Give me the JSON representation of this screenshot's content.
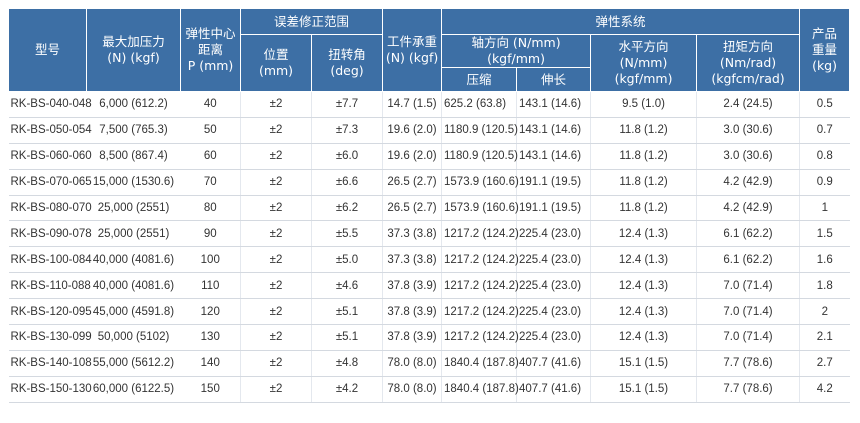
{
  "headers": {
    "model": "型号",
    "max_force": [
      "最大加压力",
      "(N) (kgf)"
    ],
    "elastic_center": [
      "弹性中心",
      "距离",
      "P (mm)"
    ],
    "error_correction": "误差修正范围",
    "position": [
      "位置",
      "(mm)"
    ],
    "torsion_angle": [
      "扭转角",
      "(deg)"
    ],
    "workpiece_load": [
      "工件承重",
      "(N) (kgf)"
    ],
    "elastic_system": "弹性系统",
    "axial": "轴方向 (N/mm) (kgf/mm)",
    "compression": "压缩",
    "extension": "伸长",
    "horizontal": [
      "水平方向",
      "(N/mm) (kgf/mm)"
    ],
    "torque": [
      "扭矩方向 (Nm/rad)",
      "(kgfcm/rad)"
    ],
    "weight": [
      "产品",
      "重量",
      "(kg)"
    ]
  },
  "rows": [
    {
      "model": "RK-BS-040-048",
      "force": "6,000 (612.2)",
      "p": "40",
      "pos": "±2",
      "angle": "±7.7",
      "load": "14.7 (1.5)",
      "comp": "625.2 (63.8)",
      "ext": "143.1 (14.6)",
      "horiz": "9.5 (1.0)",
      "torque": "2.4 (24.5)",
      "weight": "0.5"
    },
    {
      "model": "RK-BS-050-054",
      "force": "7,500 (765.3)",
      "p": "50",
      "pos": "±2",
      "angle": "±7.3",
      "load": "19.6 (2.0)",
      "comp": "1180.9 (120.5)",
      "ext": "143.1 (14.6)",
      "horiz": "11.8 (1.2)",
      "torque": "3.0 (30.6)",
      "weight": "0.7"
    },
    {
      "model": "RK-BS-060-060",
      "force": "8,500 (867.4)",
      "p": "60",
      "pos": "±2",
      "angle": "±6.0",
      "load": "19.6 (2.0)",
      "comp": "1180.9 (120.5)",
      "ext": "143.1 (14.6)",
      "horiz": "11.8 (1.2)",
      "torque": "3.0 (30.6)",
      "weight": "0.8"
    },
    {
      "model": "RK-BS-070-065",
      "force": "15,000 (1530.6)",
      "p": "70",
      "pos": "±2",
      "angle": "±6.6",
      "load": "26.5 (2.7)",
      "comp": "1573.9 (160.6)",
      "ext": "191.1 (19.5)",
      "horiz": "11.8 (1.2)",
      "torque": "4.2 (42.9)",
      "weight": "0.9"
    },
    {
      "model": "RK-BS-080-070",
      "force": "25,000 (2551)",
      "p": "80",
      "pos": "±2",
      "angle": "±6.2",
      "load": "26.5 (2.7)",
      "comp": "1573.9 (160.6)",
      "ext": "191.1 (19.5)",
      "horiz": "11.8 (1.2)",
      "torque": "4.2 (42.9)",
      "weight": "1"
    },
    {
      "model": "RK-BS-090-078",
      "force": "25,000 (2551)",
      "p": "90",
      "pos": "±2",
      "angle": "±5.5",
      "load": "37.3 (3.8)",
      "comp": "1217.2 (124.2)",
      "ext": "225.4 (23.0)",
      "horiz": "12.4 (1.3)",
      "torque": "6.1 (62.2)",
      "weight": "1.5"
    },
    {
      "model": "RK-BS-100-084",
      "force": "40,000 (4081.6)",
      "p": "100",
      "pos": "±2",
      "angle": "±5.0",
      "load": "37.3 (3.8)",
      "comp": "1217.2 (124.2)",
      "ext": "225.4 (23.0)",
      "horiz": "12.4 (1.3)",
      "torque": "6.1 (62.2)",
      "weight": "1.6"
    },
    {
      "model": "RK-BS-110-088",
      "force": "40,000 (4081.6)",
      "p": "110",
      "pos": "±2",
      "angle": "±4.6",
      "load": "37.8 (3.9)",
      "comp": "1217.2 (124.2)",
      "ext": "225.4 (23.0)",
      "horiz": "12.4 (1.3)",
      "torque": "7.0 (71.4)",
      "weight": "1.8"
    },
    {
      "model": "RK-BS-120-095",
      "force": "45,000 (4591.8)",
      "p": "120",
      "pos": "±2",
      "angle": "±5.1",
      "load": "37.8 (3.9)",
      "comp": "1217.2 (124.2)",
      "ext": "225.4 (23.0)",
      "horiz": "12.4 (1.3)",
      "torque": "7.0 (71.4)",
      "weight": "2"
    },
    {
      "model": "RK-BS-130-099",
      "force": "50,000 (5102)",
      "p": "130",
      "pos": "±2",
      "angle": "±5.1",
      "load": "37.8 (3.9)",
      "comp": "1217.2 (124.2)",
      "ext": "225.4 (23.0)",
      "horiz": "12.4 (1.3)",
      "torque": "7.0 (71.4)",
      "weight": "2.1"
    },
    {
      "model": "RK-BS-140-108",
      "force": "55,000 (5612.2)",
      "p": "140",
      "pos": "±2",
      "angle": "±4.8",
      "load": "78.0 (8.0)",
      "comp": "1840.4 (187.8)",
      "ext": "407.7 (41.6)",
      "horiz": "15.1 (1.5)",
      "torque": "7.7 (78.6)",
      "weight": "2.7"
    },
    {
      "model": "RK-BS-150-130",
      "force": "60,000 (6122.5)",
      "p": "150",
      "pos": "±2",
      "angle": "±4.2",
      "load": "78.0 (8.0)",
      "comp": "1840.4 (187.8)",
      "ext": "407.7 (41.6)",
      "horiz": "15.1 (1.5)",
      "torque": "7.7 (78.6)",
      "weight": "4.2"
    }
  ]
}
